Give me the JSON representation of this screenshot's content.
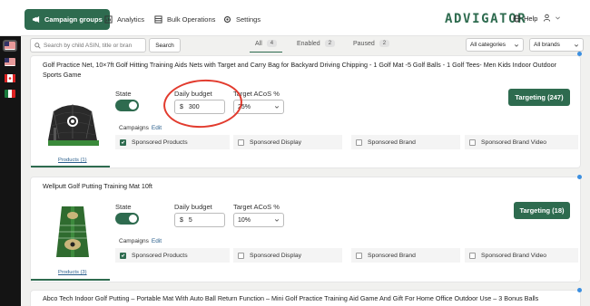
{
  "nav": {
    "tabs": [
      {
        "label": "Campaign groups",
        "icon": "campaign-groups-icon"
      },
      {
        "label": "Analytics",
        "icon": "analytics-icon"
      },
      {
        "label": "Bulk Operations",
        "icon": "bulk-operations-icon"
      },
      {
        "label": "Settings",
        "icon": "settings-icon"
      }
    ],
    "logo_main": "ADVIGATOR",
    "help": "Help"
  },
  "filters": {
    "search_placeholder": "Search by child ASIN, title or bran",
    "search_button": "Search",
    "tabs": [
      {
        "label": "All",
        "count": "4"
      },
      {
        "label": "Enabled",
        "count": "2"
      },
      {
        "label": "Paused",
        "count": "2"
      }
    ],
    "categories": "All categories",
    "brands": "All brands"
  },
  "labels": {
    "state": "State",
    "daily_budget": "Daily budget",
    "target_acos": "Target ACoS %",
    "campaigns": "Campaigns",
    "edit": "Edit",
    "currency": "$"
  },
  "cards": [
    {
      "title": "Golf Practice Net, 10×7ft Golf Hitting Training Aids Nets with Target and Carry Bag for Backyard Driving Chipping - 1 Golf Mat -5 Golf Balls - 1 Golf Tees- Men Kids Indoor Outdoor Sports Game",
      "budget": "300",
      "acos": "25%",
      "targeting": "Targeting (247)",
      "products": "Products (1)",
      "campaign_types": [
        {
          "label": "Sponsored Products",
          "checked": true
        },
        {
          "label": "Sponsored Display",
          "checked": false
        },
        {
          "label": "Sponsored Brand",
          "checked": false
        },
        {
          "label": "Sponsored Brand Video",
          "checked": false
        }
      ]
    },
    {
      "title": "Wellputt Golf Putting Training Mat 10ft",
      "budget": "5",
      "acos": "10%",
      "targeting": "Targeting (18)",
      "products": "Products (3)",
      "campaign_types": [
        {
          "label": "Sponsored Products",
          "checked": true
        },
        {
          "label": "Sponsored Display",
          "checked": false
        },
        {
          "label": "Sponsored Brand",
          "checked": false
        },
        {
          "label": "Sponsored Brand Video",
          "checked": false
        }
      ]
    },
    {
      "title": "Abco Tech Indoor Golf Putting – Portable Mat With Auto Ball Return Function – Mini Golf Practice Training Aid Game And Gift For Home Office Outdoor Use – 3 Bonus Balls"
    }
  ],
  "colors": {
    "brand": "#2e6b4f",
    "annotation": "#e23b2e",
    "link": "#2a5f8c"
  }
}
